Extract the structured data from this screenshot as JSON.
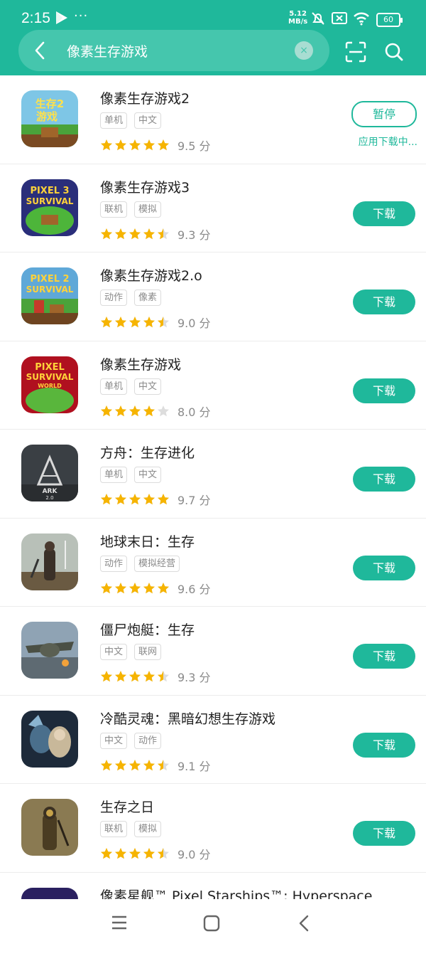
{
  "status_bar": {
    "time": "2:15",
    "dots": "···",
    "speed_value": "5.12",
    "speed_unit": "MB/s",
    "battery": "60"
  },
  "search": {
    "query": "像素生存游戏",
    "clear_symbol": "×"
  },
  "colors": {
    "accent": "#1fb89b",
    "star": "#f6b400",
    "star_empty": "#dddddd"
  },
  "apps": [
    {
      "name": "像素生存游戏2",
      "tags": [
        "单机",
        "中文"
      ],
      "rating": 5,
      "score": "9.5 分",
      "action": "暂停",
      "status": "应用下载中...",
      "downloading": true
    },
    {
      "name": "像素生存游戏3",
      "tags": [
        "联机",
        "模拟"
      ],
      "rating": 4.5,
      "score": "9.3 分",
      "action": "下载"
    },
    {
      "name": "像素生存游戏2.o",
      "tags": [
        "动作",
        "像素"
      ],
      "rating": 4.5,
      "score": "9.0 分",
      "action": "下载"
    },
    {
      "name": "像素生存游戏",
      "tags": [
        "单机",
        "中文"
      ],
      "rating": 4,
      "score": "8.0 分",
      "action": "下载"
    },
    {
      "name": "方舟：生存进化",
      "tags": [
        "单机",
        "中文"
      ],
      "rating": 5,
      "score": "9.7 分",
      "action": "下载"
    },
    {
      "name": "地球末日：生存",
      "tags": [
        "动作",
        "模拟经营"
      ],
      "rating": 5,
      "score": "9.6 分",
      "action": "下载"
    },
    {
      "name": "僵尸炮艇：生存",
      "tags": [
        "中文",
        "联网"
      ],
      "rating": 4.5,
      "score": "9.3 分",
      "action": "下载"
    },
    {
      "name": "冷酷灵魂：黑暗幻想生存游戏",
      "tags": [
        "中文",
        "动作"
      ],
      "rating": 4.5,
      "score": "9.1 分",
      "action": "下载"
    },
    {
      "name": "生存之日",
      "tags": [
        "联机",
        "模拟"
      ],
      "rating": 4.5,
      "score": "9.0 分",
      "action": "下载"
    },
    {
      "name": "像素星舰™ Pixel Starships™: Hyperspace",
      "tags": [],
      "rating": 0,
      "score": "",
      "action": ""
    }
  ],
  "icon_texts": {
    "a0": [
      "生存2",
      "游戏"
    ],
    "a1": [
      "PIXEL 3",
      "SURVIVAL"
    ],
    "a2": [
      "PIXEL 2",
      "SURVIVAL"
    ],
    "a3": [
      "PIXEL",
      "SURVIVAL",
      "WORLD"
    ],
    "a4": [
      "ARK",
      "2.0"
    ]
  }
}
